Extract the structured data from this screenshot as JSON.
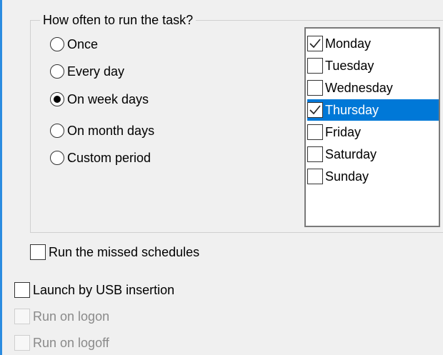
{
  "schedule": {
    "title": "How often to run the task?",
    "frequency_options": [
      {
        "label": "Once",
        "selected": false
      },
      {
        "label": "Every day",
        "selected": false
      },
      {
        "label": "On week days",
        "selected": true
      },
      {
        "label": "On month days",
        "selected": false
      },
      {
        "label": "Custom period",
        "selected": false
      }
    ],
    "weekdays": [
      {
        "label": "Monday",
        "checked": true,
        "highlighted": false
      },
      {
        "label": "Tuesday",
        "checked": false,
        "highlighted": false
      },
      {
        "label": "Wednesday",
        "checked": false,
        "highlighted": false
      },
      {
        "label": "Thursday",
        "checked": true,
        "highlighted": true
      },
      {
        "label": "Friday",
        "checked": false,
        "highlighted": false
      },
      {
        "label": "Saturday",
        "checked": false,
        "highlighted": false
      },
      {
        "label": "Sunday",
        "checked": false,
        "highlighted": false
      }
    ]
  },
  "options": {
    "run_missed": {
      "label": "Run the missed schedules",
      "checked": false,
      "enabled": true
    },
    "usb_launch": {
      "label": "Launch by USB insertion",
      "checked": false,
      "enabled": true
    },
    "run_logon": {
      "label": "Run on logon",
      "checked": false,
      "enabled": false
    },
    "run_logoff": {
      "label": "Run on logoff",
      "checked": false,
      "enabled": false
    }
  },
  "colors": {
    "selection": "#0078d7",
    "window_accent": "#2b8ce0",
    "disabled_text": "#8a8a8a"
  }
}
